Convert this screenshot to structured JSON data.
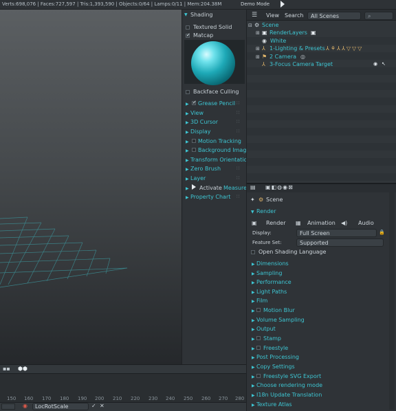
{
  "topbar": {
    "info": "Verts:698,076 | Faces:727,597 | Tris:1,393,590 | Objects:0/64 | Lamps:0/11 | Mem:204.38M",
    "mode": "Demo Mode"
  },
  "shading": {
    "title": "Shading",
    "textured_solid": "Textured Solid",
    "matcap": "Matcap",
    "backface": "Backface Culling"
  },
  "panels": [
    {
      "label": "Grease Pencil"
    },
    {
      "label": "View"
    },
    {
      "label": "3D Cursor"
    },
    {
      "label": "Display"
    },
    {
      "label": "Motion Tracking"
    },
    {
      "label": "Background Images"
    },
    {
      "label": "Transform Orientations"
    },
    {
      "label": "Zero Brush"
    },
    {
      "label": "Layer"
    },
    {
      "label": "Activate",
      "extra": "Measure"
    },
    {
      "label": "Property Chart"
    }
  ],
  "outliner": {
    "view": "View",
    "search": "Search",
    "scenes": "All Scenes",
    "items": [
      {
        "label": "Scene"
      },
      {
        "label": "RenderLayers"
      },
      {
        "label": "White"
      },
      {
        "label": "1-Lighting & Presets"
      },
      {
        "label": "2 Camera"
      },
      {
        "label": "3-Focus Camera Target"
      }
    ]
  },
  "properties": {
    "scene": "Scene",
    "render": "Render",
    "tabs": {
      "render": "Render",
      "animation": "Animation",
      "audio": "Audio"
    },
    "display_label": "Display:",
    "display_value": "Full Screen",
    "feature_label": "Feature Set:",
    "feature_value": "Supported",
    "osl": "Open Shading Language",
    "sections": [
      {
        "label": "Dimensions"
      },
      {
        "label": "Sampling"
      },
      {
        "label": "Performance"
      },
      {
        "label": "Light Paths"
      },
      {
        "label": "Film"
      },
      {
        "label": "Motion Blur"
      },
      {
        "label": "Volume Sampling"
      },
      {
        "label": "Output"
      },
      {
        "label": "Stamp"
      },
      {
        "label": "Freestyle"
      },
      {
        "label": "Post Processing"
      },
      {
        "label": "Copy Settings"
      },
      {
        "label": "Freestyle SVG Export"
      },
      {
        "label": "Choose rendering mode"
      },
      {
        "label": "I18n Update Translation"
      },
      {
        "label": "Texture Atlas"
      }
    ]
  },
  "timeline": {
    "ticks": [
      "150",
      "160",
      "170",
      "180",
      "190",
      "200",
      "210",
      "220",
      "230",
      "240",
      "250",
      "260",
      "270",
      "280"
    ],
    "keying_set": "LocRotScale"
  }
}
